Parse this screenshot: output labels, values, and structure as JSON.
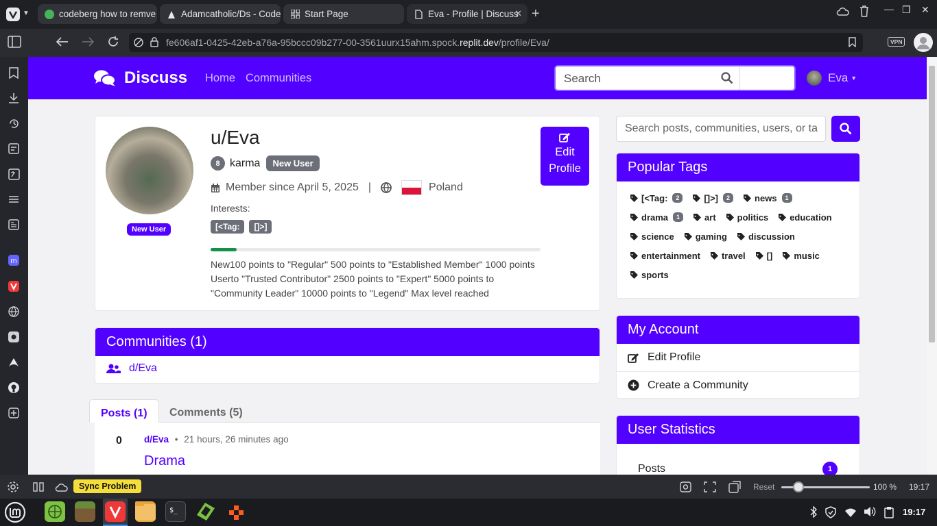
{
  "browser": {
    "tabs": [
      {
        "title": "codeberg how to remve…"
      },
      {
        "title": "Adamcatholic/Ds - Code…"
      },
      {
        "title": "Start Page"
      },
      {
        "title": "Eva - Profile | Discuss"
      }
    ],
    "url": {
      "prefix": "fe606af1-0425-42eb-a76a-95bccc09b277-00-3561uurx15ahm.spock.",
      "domain": "replit.dev",
      "path": "/profile/Eva/"
    },
    "vpn_label": "VPN"
  },
  "site": {
    "brand": "Discuss",
    "nav": [
      "Home",
      "Communities"
    ],
    "search_placeholder": "Search",
    "user": "Eva"
  },
  "profile": {
    "username": "u/Eva",
    "avatar_badge": "New User",
    "karma_count": "8",
    "karma_label": "karma",
    "status_badge": "New User",
    "member_since": "Member since April 5, 2025",
    "separator": "|",
    "country": "Poland",
    "interests_label": "Interests:",
    "interests": [
      "[<Tag:",
      "[]>]"
    ],
    "progress_percent": 8,
    "levels_text": "New100 points to \"Regular\" 500 points to \"Established Member\" 1000 points Userto \"Trusted Contributor\" 2500 points to \"Expert\" 5000 points to \"Community Leader\" 10000 points to \"Legend\" Max level reached",
    "edit_line1": "Edit",
    "edit_line2": "Profile"
  },
  "communities": {
    "heading": "Communities (1)",
    "items": [
      "d/Eva"
    ]
  },
  "content_tabs": {
    "posts": "Posts (1)",
    "comments": "Comments (5)"
  },
  "post": {
    "score": "0",
    "community": "d/Eva",
    "dot": "•",
    "time": "21 hours, 26 minutes ago",
    "title": "Drama"
  },
  "sidebar": {
    "search_placeholder": "Search posts, communities, users, or ta",
    "popular_tags_heading": "Popular Tags",
    "tags": [
      {
        "name": "[<Tag:",
        "count": "2"
      },
      {
        "name": "[]>]",
        "count": "2"
      },
      {
        "name": "news",
        "count": "1"
      },
      {
        "name": "drama",
        "count": "1"
      },
      {
        "name": "art",
        "count": ""
      },
      {
        "name": "politics",
        "count": ""
      },
      {
        "name": "education",
        "count": ""
      },
      {
        "name": "science",
        "count": ""
      },
      {
        "name": "gaming",
        "count": ""
      },
      {
        "name": "discussion",
        "count": ""
      },
      {
        "name": "entertainment",
        "count": ""
      },
      {
        "name": "travel",
        "count": ""
      },
      {
        "name": "[]",
        "count": ""
      },
      {
        "name": "music",
        "count": ""
      },
      {
        "name": "sports",
        "count": ""
      }
    ],
    "account_heading": "My Account",
    "account_items": [
      "Edit Profile",
      "Create a Community"
    ],
    "stats_heading": "User Statistics",
    "stats": [
      {
        "label": "Posts",
        "value": "1"
      }
    ]
  },
  "statusbar": {
    "sync": "Sync Problem",
    "reset": "Reset",
    "zoom": "100 %",
    "time": "19:17"
  },
  "taskbar": {
    "clock": "19:17"
  },
  "colors": {
    "accent": "#5200ff",
    "sync": "#f5dd3a",
    "progress": "#159047"
  }
}
